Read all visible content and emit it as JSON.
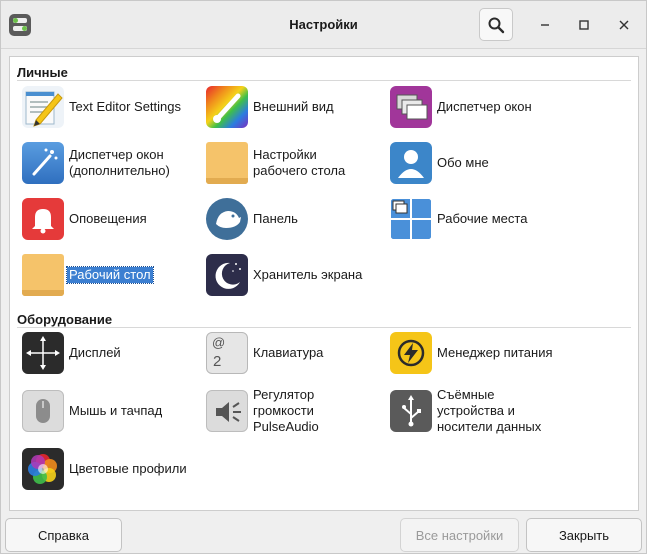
{
  "window": {
    "title": "Настройки"
  },
  "sections": [
    {
      "title": "Личные",
      "items": [
        {
          "label": "Text Editor Settings",
          "icon": "text-editor-icon"
        },
        {
          "label": "Внешний вид",
          "icon": "appearance-icon"
        },
        {
          "label": "Диспетчер окон",
          "icon": "window-manager-icon"
        },
        {
          "label": "Диспетчер окон (дополнительно)",
          "icon": "window-manager-tweaks-icon"
        },
        {
          "label": "Настройки рабочего стола",
          "icon": "desktop-settings-folder-icon"
        },
        {
          "label": "Обо мне",
          "icon": "about-me-icon"
        },
        {
          "label": "Оповещения",
          "icon": "notifications-bell-icon"
        },
        {
          "label": "Панель",
          "icon": "panel-mouse-icon"
        },
        {
          "label": "Рабочие места",
          "icon": "workspaces-icon"
        },
        {
          "label": "Рабочий стол",
          "icon": "desktop-folder-icon",
          "selected": true
        },
        {
          "label": "Хранитель экрана",
          "icon": "screensaver-moon-icon"
        }
      ]
    },
    {
      "title": "Оборудование",
      "items": [
        {
          "label": "Дисплей",
          "icon": "display-icon"
        },
        {
          "label": "Клавиатура",
          "icon": "keyboard-key-icon",
          "key_top": "@",
          "key_bottom": "2"
        },
        {
          "label": "Менеджер питания",
          "icon": "power-manager-icon"
        },
        {
          "label": "Мышь и тачпад",
          "icon": "mouse-icon"
        },
        {
          "label": "Регулятор громкости PulseAudio",
          "icon": "volume-speaker-icon"
        },
        {
          "label": "Съёмные устройства и носители данных",
          "icon": "usb-icon"
        },
        {
          "label": "Цветовые профили",
          "icon": "color-profiles-icon"
        }
      ]
    }
  ],
  "buttons": {
    "help": "Справка",
    "all_settings": "Все настройки",
    "close": "Закрыть"
  },
  "colors": {
    "selection": "#3c7fd1",
    "appearance_purple": "#7b2fbf",
    "window_manager_magenta": "#a1369a",
    "notification_red": "#e53a3a",
    "power_yellow": "#f5c518",
    "blue_accent": "#3a7fc4"
  }
}
